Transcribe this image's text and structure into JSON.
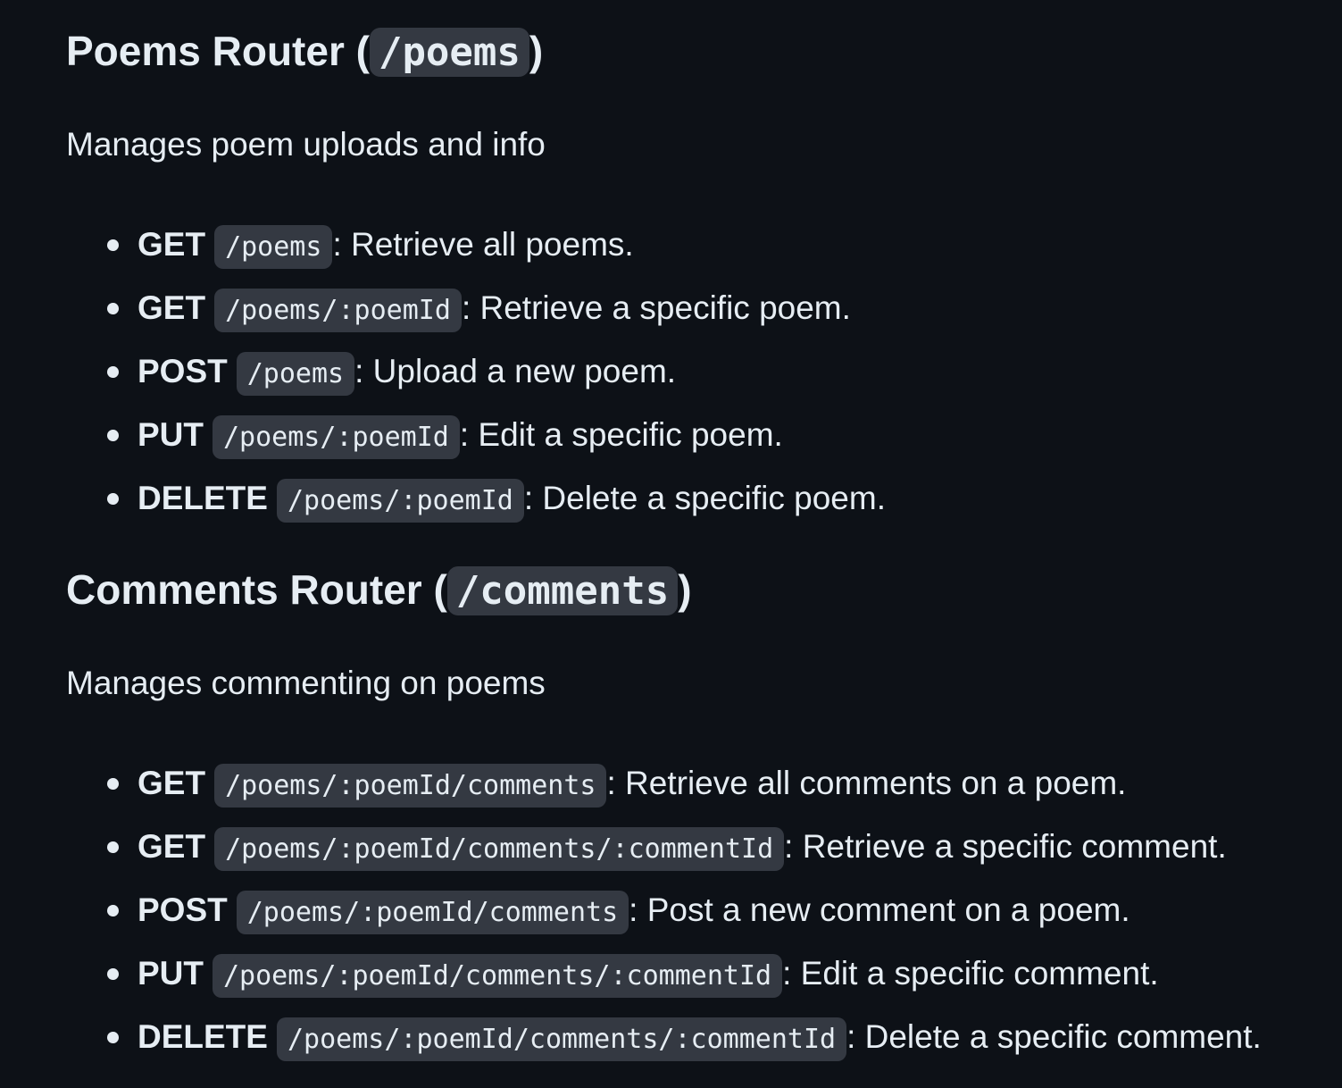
{
  "sections": [
    {
      "title_text": "Poems Router (",
      "title_code": "/poems",
      "title_close": ")",
      "description": "Manages poem uploads and info",
      "routes": [
        {
          "method": "GET",
          "path": "/poems",
          "desc": ": Retrieve all poems."
        },
        {
          "method": "GET",
          "path": "/poems/:poemId",
          "desc": ": Retrieve a specific poem."
        },
        {
          "method": "POST",
          "path": "/poems",
          "desc": ": Upload a new poem."
        },
        {
          "method": "PUT",
          "path": "/poems/:poemId",
          "desc": ": Edit a specific poem."
        },
        {
          "method": "DELETE",
          "path": "/poems/:poemId",
          "desc": ": Delete a specific poem."
        }
      ]
    },
    {
      "title_text": "Comments Router (",
      "title_code": "/comments",
      "title_close": ")",
      "description": "Manages commenting on poems",
      "routes": [
        {
          "method": "GET",
          "path": "/poems/:poemId/comments",
          "desc": ": Retrieve all comments on a poem."
        },
        {
          "method": "GET",
          "path": "/poems/:poemId/comments/:commentId",
          "desc": ": Retrieve a specific comment."
        },
        {
          "method": "POST",
          "path": "/poems/:poemId/comments",
          "desc": ": Post a new comment on a poem."
        },
        {
          "method": "PUT",
          "path": "/poems/:poemId/comments/:commentId",
          "desc": ": Edit a specific comment."
        },
        {
          "method": "DELETE",
          "path": "/poems/:poemId/comments/:commentId",
          "desc": ": Delete a specific comment."
        }
      ]
    }
  ]
}
